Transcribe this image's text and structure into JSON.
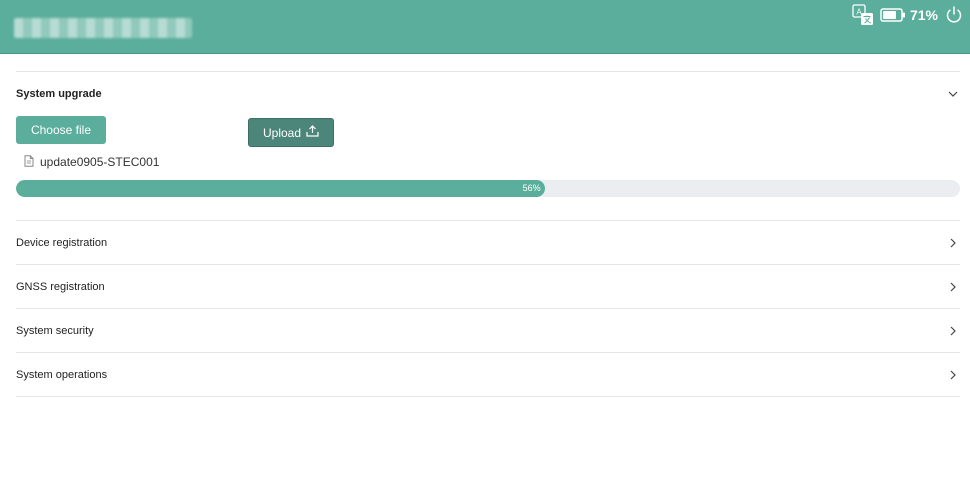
{
  "topbar": {
    "translate_icon": "translate-icon",
    "battery_icon": "battery-icon",
    "battery_percent": "71%",
    "power_icon": "power-icon"
  },
  "upgrade": {
    "title": "System upgrade",
    "choose_label": "Choose file",
    "upload_label": "Upload",
    "file_name": "update0905-STEC001",
    "progress_label": "56%",
    "progress_value": 0.56
  },
  "sections": [
    {
      "label": "Device registration"
    },
    {
      "label": "GNSS registration"
    },
    {
      "label": "System security"
    },
    {
      "label": "System operations"
    }
  ],
  "colors": {
    "accent": "#5aae9b",
    "accent_dark": "#4c8579",
    "track": "#ecedf1"
  }
}
